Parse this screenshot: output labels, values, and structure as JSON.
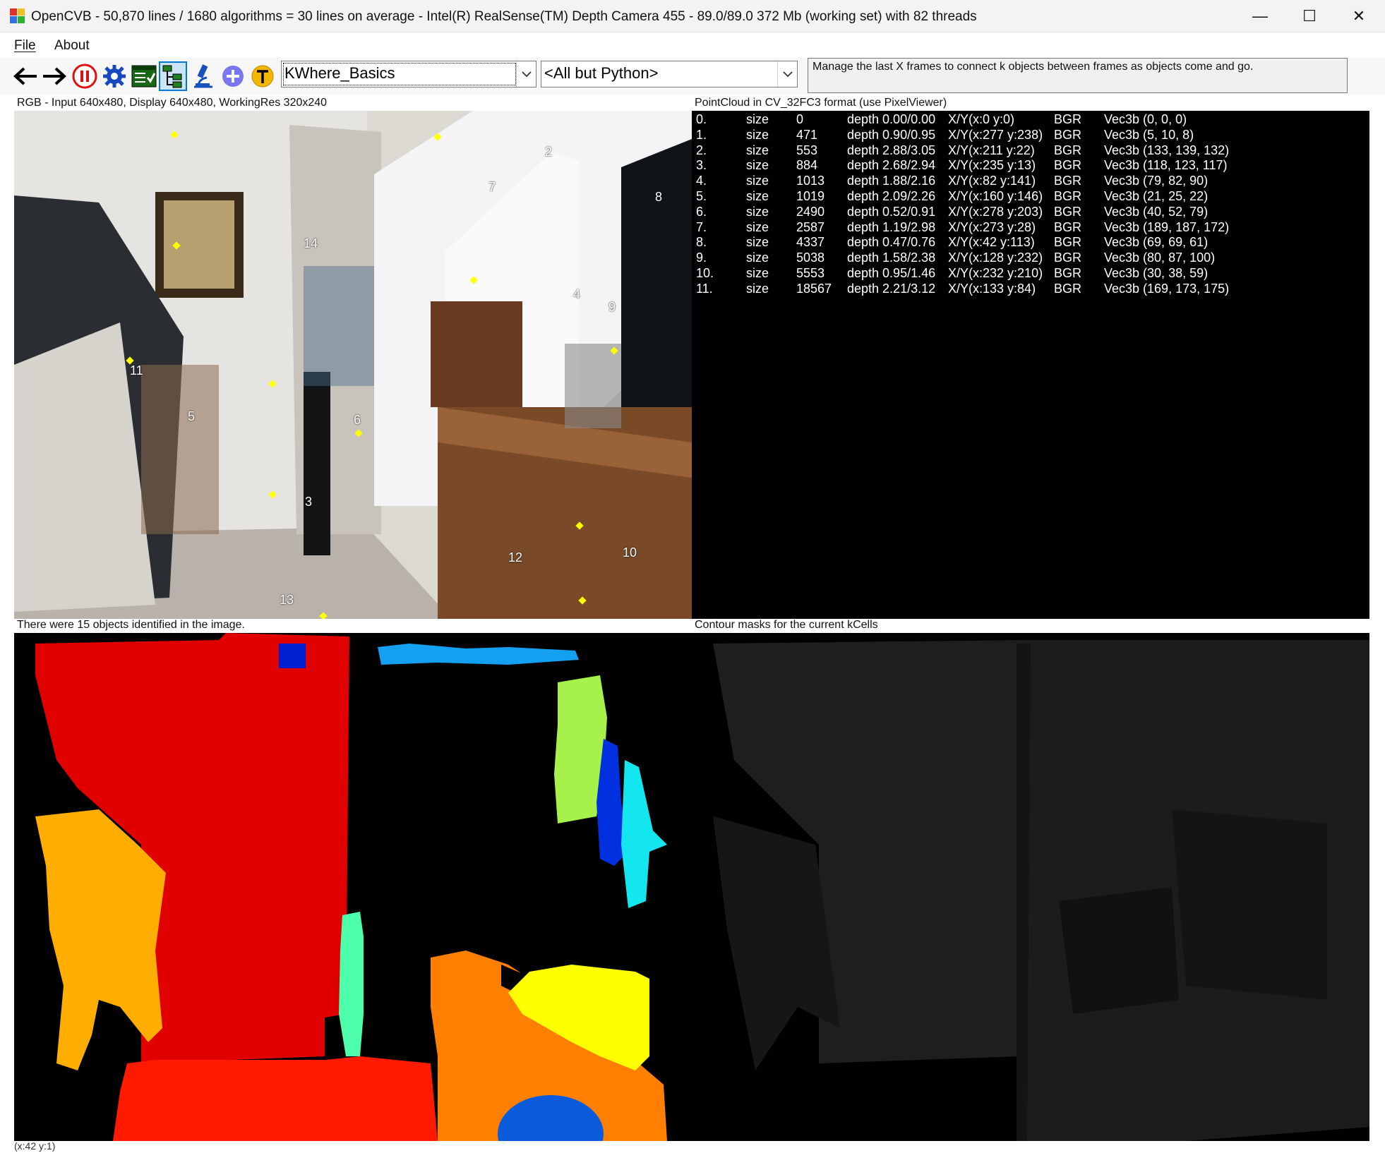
{
  "window": {
    "title": "OpenCVB - 50,870 lines / 1680 algorithms = 30 lines on average - Intel(R) RealSense(TM) Depth Camera 455 - 89.0/89.0 372 Mb (working set) with 82 threads",
    "minimize": "—",
    "maximize": "☐",
    "close": "✕"
  },
  "menu": {
    "file": "File",
    "about": "About"
  },
  "toolbar": {
    "buttons": [
      "back-icon",
      "forward-icon",
      "pause-icon",
      "settings-icon",
      "test-all-icon",
      "tree-view-icon",
      "microscope-icon",
      "add-icon",
      "translate-icon"
    ],
    "algorithm": "KWhere_Basics",
    "group": "<All but Python>",
    "description": "Manage the last X frames to connect k objects between frames as objects come and go."
  },
  "panels": {
    "rgb_label": "RGB - Input 640x480, Display 640x480, WorkingRes 320x240",
    "pointcloud_label": "PointCloud in CV_32FC3 format (use PixelViewer)",
    "mask_label": "There were 15 objects identified in the image.",
    "contour_label": "Contour masks for the current kCells"
  },
  "objects": [
    "2",
    "7",
    "8",
    "14",
    "4",
    "9",
    "11",
    "5",
    "6",
    "3",
    "12",
    "10",
    "13"
  ],
  "pointcloud_rows": [
    {
      "idx": "0.",
      "size_label": "size",
      "size": "0",
      "depth": "depth 0.00/0.00",
      "xy": "X/Y(x:0 y:0)",
      "fmt": "BGR",
      "vec": "Vec3b (0, 0, 0)"
    },
    {
      "idx": "1.",
      "size_label": "size",
      "size": "471",
      "depth": "depth 0.90/0.95",
      "xy": "X/Y(x:277 y:238)",
      "fmt": "BGR",
      "vec": "Vec3b (5, 10, 8)"
    },
    {
      "idx": "2.",
      "size_label": "size",
      "size": "553",
      "depth": "depth 2.88/3.05",
      "xy": "X/Y(x:211 y:22)",
      "fmt": "BGR",
      "vec": "Vec3b (133, 139, 132)"
    },
    {
      "idx": "3.",
      "size_label": "size",
      "size": "884",
      "depth": "depth 2.68/2.94",
      "xy": "X/Y(x:235 y:13)",
      "fmt": "BGR",
      "vec": "Vec3b (118, 123, 117)"
    },
    {
      "idx": "4.",
      "size_label": "size",
      "size": "1013",
      "depth": "depth 1.88/2.16",
      "xy": "X/Y(x:82 y:141)",
      "fmt": "BGR",
      "vec": "Vec3b (79, 82, 90)"
    },
    {
      "idx": "5.",
      "size_label": "size",
      "size": "1019",
      "depth": "depth 2.09/2.26",
      "xy": "X/Y(x:160 y:146)",
      "fmt": "BGR",
      "vec": "Vec3b (21, 25, 22)"
    },
    {
      "idx": "6.",
      "size_label": "size",
      "size": "2490",
      "depth": "depth 0.52/0.91",
      "xy": "X/Y(x:278 y:203)",
      "fmt": "BGR",
      "vec": "Vec3b (40, 52, 79)"
    },
    {
      "idx": "7.",
      "size_label": "size",
      "size": "2587",
      "depth": "depth 1.19/2.98",
      "xy": "X/Y(x:273 y:28)",
      "fmt": "BGR",
      "vec": "Vec3b (189, 187, 172)"
    },
    {
      "idx": "8.",
      "size_label": "size",
      "size": "4337",
      "depth": "depth 0.47/0.76",
      "xy": "X/Y(x:42 y:113)",
      "fmt": "BGR",
      "vec": "Vec3b (69, 69, 61)"
    },
    {
      "idx": "9.",
      "size_label": "size",
      "size": "5038",
      "depth": "depth 1.58/2.38",
      "xy": "X/Y(x:128 y:232)",
      "fmt": "BGR",
      "vec": "Vec3b (80, 87, 100)"
    },
    {
      "idx": "10.",
      "size_label": "size",
      "size": "5553",
      "depth": "depth 0.95/1.46",
      "xy": "X/Y(x:232 y:210)",
      "fmt": "BGR",
      "vec": "Vec3b (30, 38, 59)"
    },
    {
      "idx": "11.",
      "size_label": "size",
      "size": "18567",
      "depth": "depth 2.21/3.12",
      "xy": "X/Y(x:133 y:84)",
      "fmt": "BGR",
      "vec": "Vec3b (169, 173, 175)"
    }
  ],
  "status": {
    "coords": "(x:42 y:1)"
  },
  "colors": {
    "red": "#e00000",
    "orange": "#ff8000",
    "amber": "#ffad00",
    "yellow": "#ffff00",
    "lime": "#a6f24a",
    "cyan": "#14e6f0",
    "sky": "#14a0f0",
    "blue": "#0020e0",
    "mint": "#4dffaa",
    "bright_red": "#ff1a00",
    "accent": "#0078d4"
  }
}
